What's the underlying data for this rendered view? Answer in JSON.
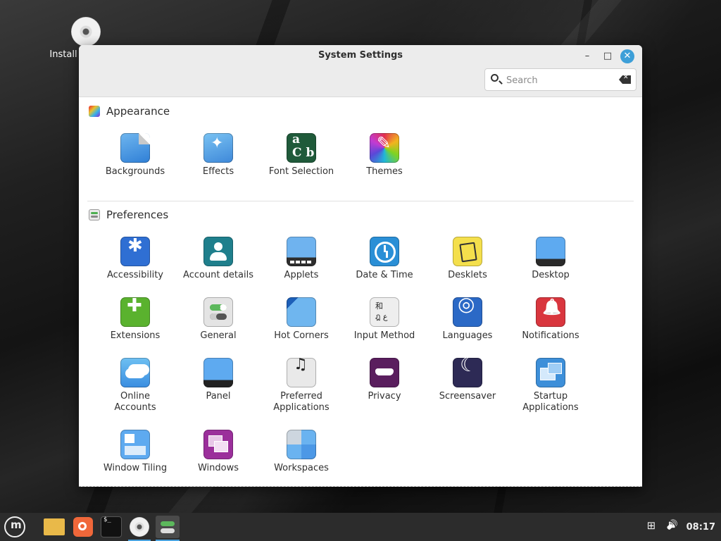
{
  "desktop": {
    "install_label": "Install"
  },
  "window": {
    "title": "System Settings",
    "search_placeholder": "Search",
    "search_value": "",
    "controls": {
      "minimize": "–",
      "maximize": "□",
      "close": "✕"
    }
  },
  "sections": {
    "appearance": {
      "title": "Appearance",
      "items": [
        {
          "label": "Backgrounds",
          "icon": "backgrounds-icon"
        },
        {
          "label": "Effects",
          "icon": "effects-icon"
        },
        {
          "label": "Font Selection",
          "icon": "font-selection-icon",
          "glyph_lines": [
            "a",
            "C b"
          ]
        },
        {
          "label": "Themes",
          "icon": "themes-icon"
        }
      ]
    },
    "preferences": {
      "title": "Preferences",
      "items": [
        {
          "label": "Accessibility",
          "icon": "accessibility-icon"
        },
        {
          "label": "Account details",
          "icon": "account-details-icon"
        },
        {
          "label": "Applets",
          "icon": "applets-icon"
        },
        {
          "label": "Date & Time",
          "icon": "clock-icon"
        },
        {
          "label": "Desklets",
          "icon": "desklets-icon"
        },
        {
          "label": "Desktop",
          "icon": "desktop-icon"
        },
        {
          "label": "Extensions",
          "icon": "puzzle-icon"
        },
        {
          "label": "General",
          "icon": "toggles-icon"
        },
        {
          "label": "Hot Corners",
          "icon": "hot-corners-icon"
        },
        {
          "label": "Input Method",
          "icon": "input-method-icon",
          "glyph_lines": [
            "和",
            "ฎ ع"
          ]
        },
        {
          "label": "Languages",
          "icon": "globe-icon"
        },
        {
          "label": "Notifications",
          "icon": "bell-icon"
        },
        {
          "label": "Online Accounts",
          "icon": "cloud-icon",
          "label_lines": [
            "Online",
            "Accounts"
          ]
        },
        {
          "label": "Panel",
          "icon": "panel-icon"
        },
        {
          "label": "Preferred Applications",
          "icon": "preferred-apps-icon",
          "label_lines": [
            "Preferred",
            "Applications"
          ]
        },
        {
          "label": "Privacy",
          "icon": "mask-icon"
        },
        {
          "label": "Screensaver",
          "icon": "moon-icon"
        },
        {
          "label": "Startup Applications",
          "icon": "startup-apps-icon",
          "label_lines": [
            "Startup",
            "Applications"
          ]
        },
        {
          "label": "Window Tiling",
          "icon": "window-tiling-icon"
        },
        {
          "label": "Windows",
          "icon": "windows-icon"
        },
        {
          "label": "Workspaces",
          "icon": "workspaces-icon"
        }
      ]
    }
  },
  "taskbar": {
    "clock": "08:17",
    "accent": "#4aa3df"
  }
}
